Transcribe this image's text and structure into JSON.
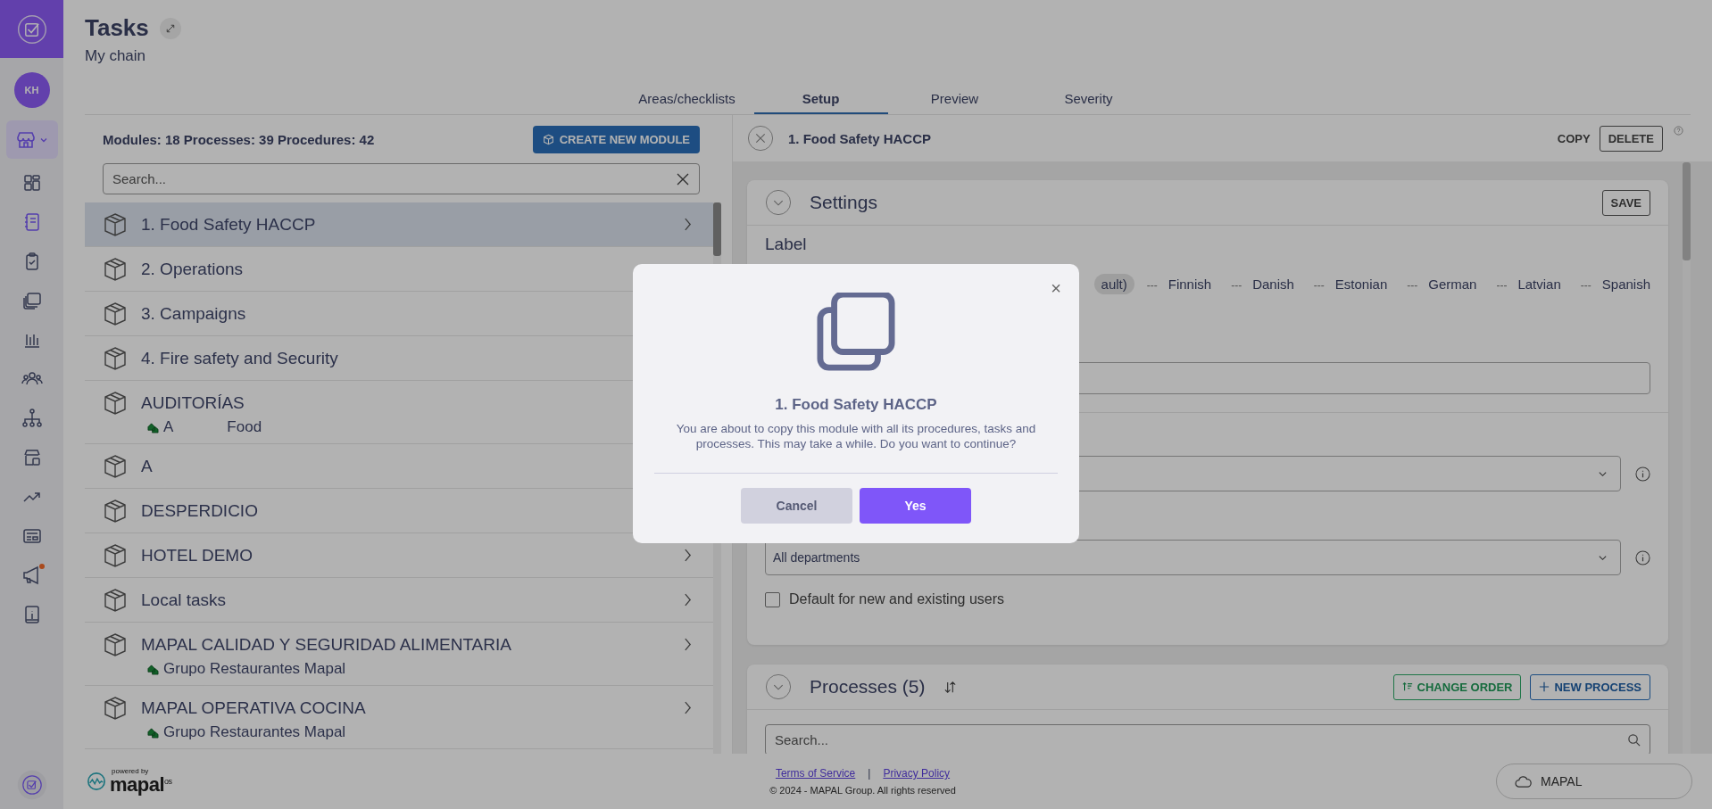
{
  "sidebar": {
    "avatar": "KH",
    "items": [
      {
        "selected": false,
        "badge": false
      },
      {
        "selected": true,
        "badge": false
      },
      {
        "selected": false,
        "badge": false
      },
      {
        "selected": false,
        "badge": false
      },
      {
        "selected": false,
        "badge": false
      },
      {
        "selected": false,
        "badge": false
      },
      {
        "selected": false,
        "badge": false
      },
      {
        "selected": false,
        "badge": false
      },
      {
        "selected": false,
        "badge": false
      },
      {
        "selected": false,
        "badge": false
      },
      {
        "selected": false,
        "badge": true
      },
      {
        "selected": false,
        "badge": false
      }
    ]
  },
  "header": {
    "title": "Tasks",
    "subtitle": "My chain"
  },
  "tabs": [
    {
      "label": "Areas/checklists",
      "selected": false
    },
    {
      "label": "Setup",
      "selected": true
    },
    {
      "label": "Preview",
      "selected": false
    },
    {
      "label": "Severity",
      "selected": false
    }
  ],
  "modules_panel": {
    "stats": "Modules: 18 Processes: 39 Procedures: 42",
    "create_button": "CREATE NEW MODULE",
    "search": {
      "placeholder": "Search..."
    },
    "items": [
      {
        "name": "1. Food Safety HACCP",
        "selected": true,
        "arrow": true
      },
      {
        "name": "2. Operations",
        "selected": false,
        "arrow": false
      },
      {
        "name": "3. Campaigns",
        "selected": false,
        "arrow": false
      },
      {
        "name": "4. Fire safety and Security",
        "selected": false,
        "arrow": false
      },
      {
        "name": "AUDITORÍAS",
        "selected": false,
        "arrow": false,
        "owner": [
          "A",
          "Food"
        ]
      },
      {
        "name": "A",
        "selected": false,
        "arrow": false
      },
      {
        "name": "DESPERDICIO",
        "selected": false,
        "arrow": false
      },
      {
        "name": "HOTEL DEMO",
        "selected": false,
        "arrow": true
      },
      {
        "name": "Local tasks",
        "selected": false,
        "arrow": true
      },
      {
        "name": "MAPAL CALIDAD Y SEGURIDAD ALIMENTARIA",
        "selected": false,
        "arrow": true,
        "owner": [
          "Grupo Restaurantes Mapal"
        ]
      },
      {
        "name": "MAPAL OPERATIVA COCINA",
        "selected": false,
        "arrow": true,
        "owner": [
          "Grupo Restaurantes Mapal"
        ]
      }
    ]
  },
  "detail": {
    "title": "1. Food Safety HACCP",
    "copy": "COPY",
    "delete": "DELETE",
    "settings": {
      "title": "Settings",
      "save": "SAVE",
      "label_heading": "Label",
      "languages": [
        {
          "name": "ault)",
          "selected": true
        },
        {
          "mark": "---",
          "name": "Finnish",
          "selected": false
        },
        {
          "mark": "---",
          "name": "Danish",
          "selected": false
        },
        {
          "mark": "---",
          "name": "Estonian",
          "selected": false
        },
        {
          "mark": "---",
          "name": "German",
          "selected": false
        },
        {
          "mark": "---",
          "name": "Latvian",
          "selected": false
        },
        {
          "mark": "---",
          "name": "Spanish",
          "selected": false
        }
      ],
      "department_select": {
        "value": "All departments"
      },
      "default_checkbox": {
        "label": "Default for new and existing users",
        "checked": false
      }
    },
    "processes": {
      "title": "Processes (5)",
      "change_order": "CHANGE ORDER",
      "new_process": "NEW PROCESS",
      "search": {
        "placeholder": "Search..."
      }
    }
  },
  "footer": {
    "powered_by": "powered by",
    "brand": "mapal",
    "brand_suffix": "os",
    "links": [
      "Terms of Service",
      "Privacy Policy"
    ],
    "separator": "|",
    "copyright": "© 2024 - MAPAL Group. All rights reserved",
    "account_button": "MAPAL"
  },
  "dialog": {
    "title": "1. Food Safety HACCP",
    "message": "You are about to copy this module with all its procedures, tasks and processes. This may take a while. Do you want to continue?",
    "close": "×",
    "buttons": [
      "Cancel",
      "Yes"
    ]
  }
}
